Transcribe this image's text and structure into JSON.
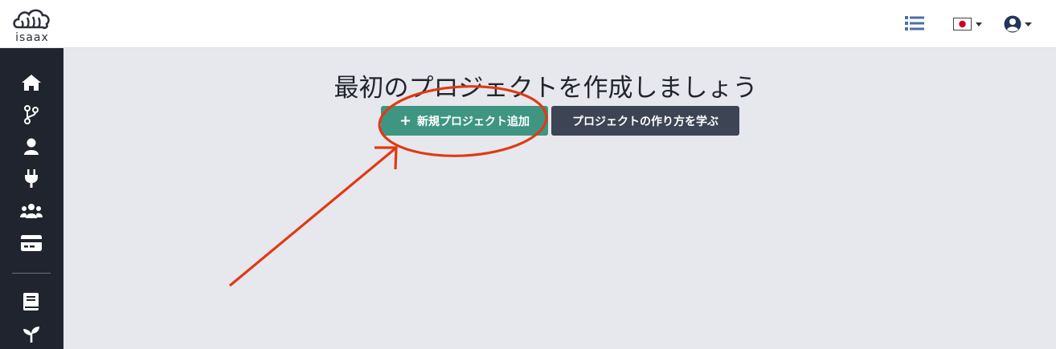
{
  "brand": {
    "logo_text": "isaax"
  },
  "topbar": {
    "icons": [
      "list-icon",
      "japan-flag-icon",
      "user-icon"
    ],
    "language_flag": "JP"
  },
  "sidebar": {
    "items": [
      {
        "icon": "home-icon"
      },
      {
        "icon": "branch-icon"
      },
      {
        "icon": "user-icon"
      },
      {
        "icon": "plug-icon"
      },
      {
        "icon": "team-icon"
      },
      {
        "icon": "card-icon"
      },
      {
        "icon": "book-icon"
      },
      {
        "icon": "sprout-icon"
      }
    ]
  },
  "main": {
    "title": "最初のプロジェクトを作成しましょう",
    "add_project_label": "新規プロジェクト追加",
    "learn_label": "プロジェクトの作り方を学ぶ"
  },
  "colors": {
    "primary": "#3e9582",
    "secondary": "#3d4453",
    "sidebar": "#20242e",
    "annotation": "#e03a14",
    "accent_blue": "#4b6fa7"
  }
}
